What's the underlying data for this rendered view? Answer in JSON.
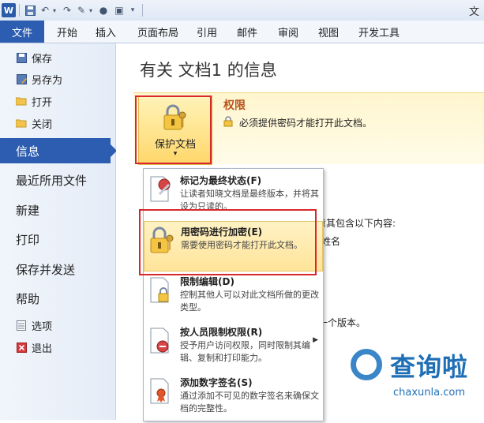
{
  "window": {
    "app_icon": "W",
    "title_fragment": "文"
  },
  "ribbon": {
    "file_tab": "文件",
    "tabs": [
      "开始",
      "插入",
      "页面布局",
      "引用",
      "邮件",
      "审阅",
      "视图",
      "开发工具"
    ]
  },
  "nav": {
    "small_top": [
      {
        "label": "保存",
        "icon": "save-icon"
      },
      {
        "label": "另存为",
        "icon": "save-as-icon"
      },
      {
        "label": "打开",
        "icon": "open-folder-icon"
      },
      {
        "label": "关闭",
        "icon": "close-folder-icon"
      }
    ],
    "big": [
      "信息",
      "最近所用文件",
      "新建",
      "打印",
      "保存并发送",
      "帮助"
    ],
    "small_bottom": [
      {
        "label": "选项",
        "icon": "options-icon"
      },
      {
        "label": "退出",
        "icon": "exit-icon"
      }
    ]
  },
  "main": {
    "heading": "有关 文档1 的信息",
    "protect_label": "保护文档",
    "protect_arrow": "▾",
    "permission_title": "权限",
    "permission_desc": "必须提供密码才能打开此文档。",
    "bg_text_1": "意其包含以下内容:",
    "bg_text_2": "姓名",
    "bg_text_3": "一个版本。"
  },
  "menu": {
    "items": [
      {
        "title": "标记为最终状态(F)",
        "desc": "让读者知晓文档是最终版本，并将其设为只读的。",
        "icon": "mark-final-icon"
      },
      {
        "title": "用密码进行加密(E)",
        "desc": "需要使用密码才能打开此文档。",
        "icon": "encrypt-lock-icon"
      },
      {
        "title": "限制编辑(D)",
        "desc": "控制其他人可以对此文档所做的更改类型。",
        "icon": "restrict-edit-icon"
      },
      {
        "title": "按人员限制权限(R)",
        "desc": "授予用户访问权限，同时限制其编辑、复制和打印能力。",
        "icon": "restrict-people-icon"
      },
      {
        "title": "添加数字签名(S)",
        "desc": "通过添加不可见的数字签名来确保文档的完整性。",
        "icon": "digital-signature-icon"
      }
    ]
  },
  "watermark": {
    "brand": "查询啦",
    "domain": "chaxunla.com"
  }
}
